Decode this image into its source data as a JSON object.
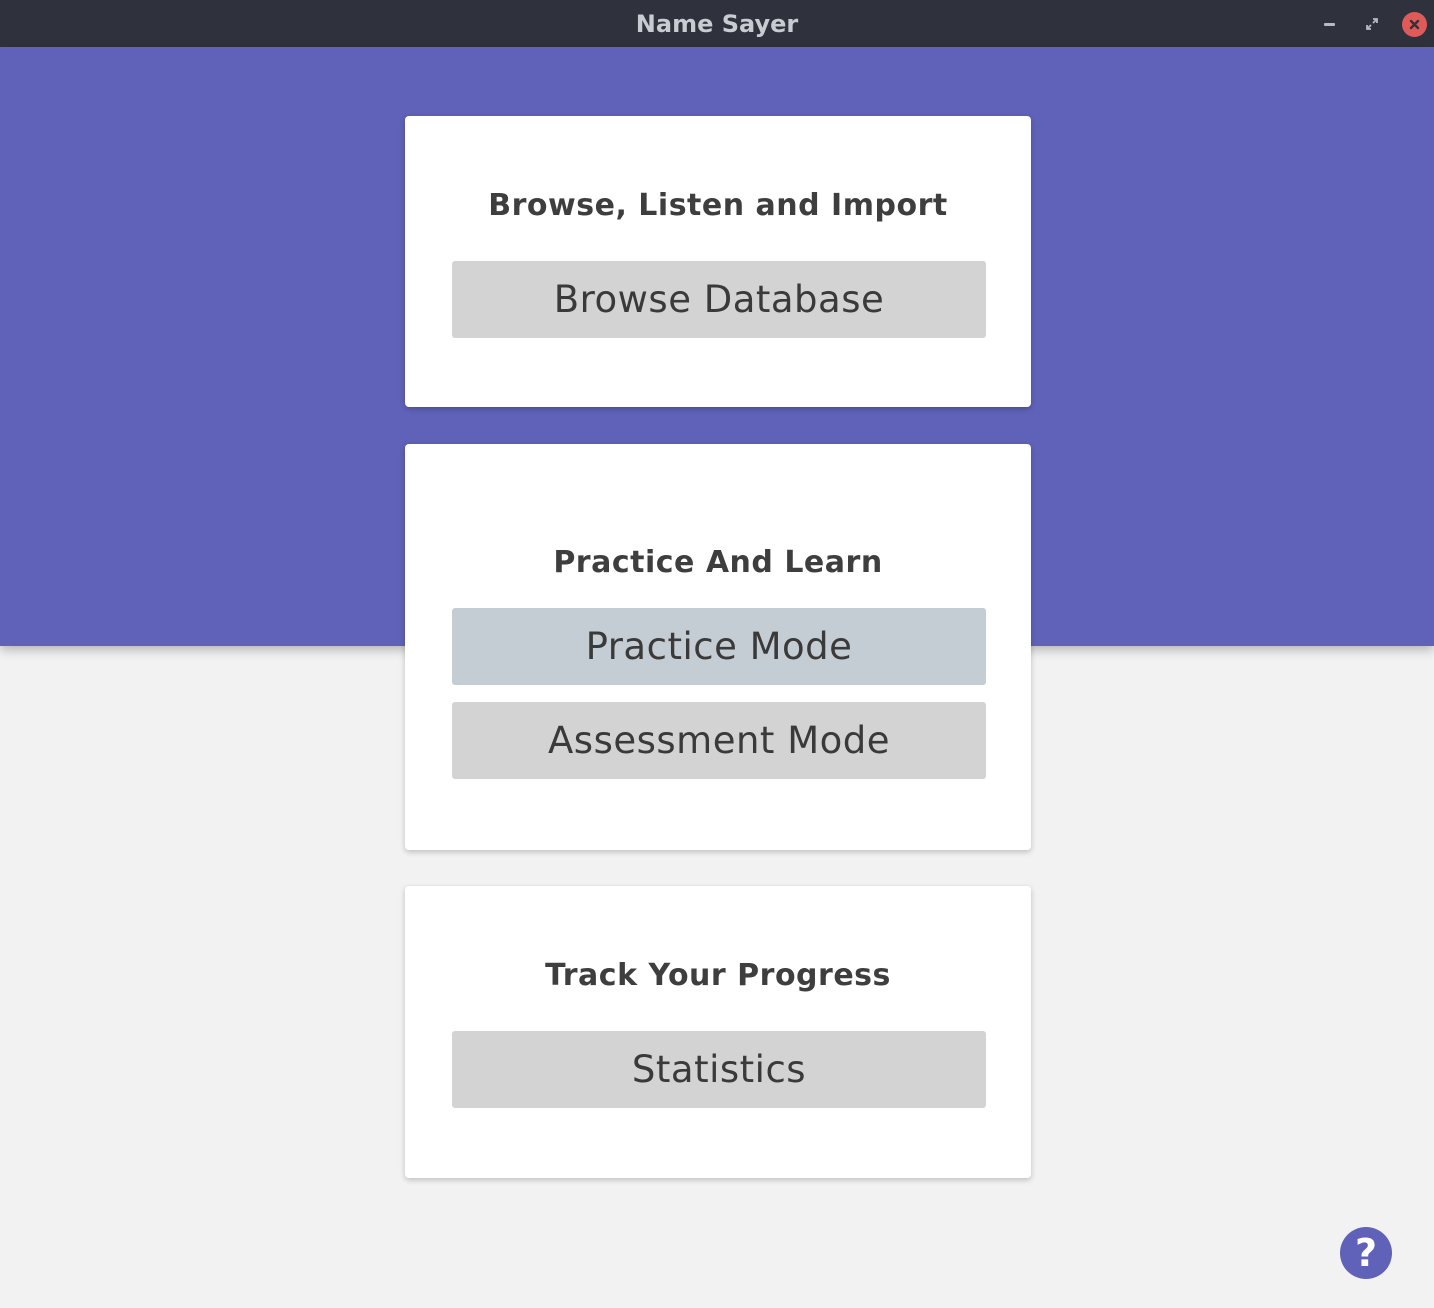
{
  "window": {
    "title": "Name Sayer",
    "accent_color": "#5f62b8",
    "titlebar_color": "#2f323c",
    "close_color": "#e05a5a"
  },
  "sections": {
    "browse": {
      "heading": "Browse, Listen and Import",
      "button": "Browse Database"
    },
    "practice": {
      "heading": "Practice And Learn",
      "practice_button": "Practice Mode",
      "assessment_button": "Assessment Mode"
    },
    "progress": {
      "heading": "Track Your Progress",
      "button": "Statistics"
    }
  },
  "help": {
    "label": "?",
    "icon": "help-icon"
  }
}
